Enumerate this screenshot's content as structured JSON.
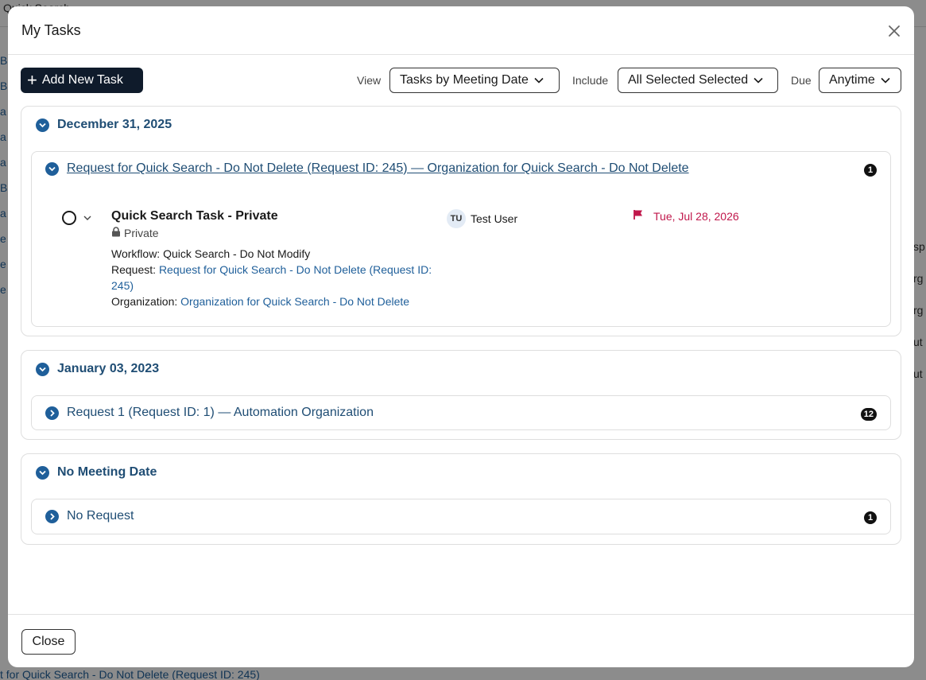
{
  "background": {
    "topbar_text": "Quick Search",
    "left_snippets": [
      "B",
      "B",
      "a",
      "a",
      "a",
      "B",
      "a",
      "e",
      "e",
      "e"
    ],
    "right_snippets": [
      "sp",
      "rg",
      "rg",
      "ut",
      "ut"
    ],
    "bottom_text": "t for Quick Search - Do Not Delete (Request ID: 245)"
  },
  "modal": {
    "title": "My Tasks",
    "close_icon": "close-icon"
  },
  "toolbar": {
    "add_label": "Add New Task",
    "view_label": "View",
    "view_value": "Tasks by Meeting Date",
    "include_label": "Include",
    "include_value": "All Selected Selected",
    "due_label": "Due",
    "due_value": "Anytime"
  },
  "groups": [
    {
      "date": "December 31, 2025",
      "expanded": true,
      "requests": [
        {
          "title": "Request for Quick Search - Do Not Delete (Request ID: 245) — Organization for Quick Search - Do Not Delete",
          "count": "1",
          "expanded": true,
          "task": {
            "title": "Quick Search Task - Private",
            "privacy": "Private",
            "workflow_label": "Workflow:",
            "workflow_value": "Quick Search - Do Not Modify",
            "request_label": "Request:",
            "request_value": "Request for Quick Search - Do Not Delete (Request ID: 245)",
            "org_label": "Organization:",
            "org_value": "Organization for Quick Search - Do Not Delete",
            "assignee_initials": "TU",
            "assignee_name": "Test User",
            "due_date": "Tue, Jul 28, 2026"
          }
        }
      ]
    },
    {
      "date": "January 03, 2023",
      "expanded": true,
      "requests": [
        {
          "title": "Request 1 (Request ID: 1) — Automation Organization",
          "count": "12",
          "expanded": false
        }
      ]
    },
    {
      "date": "No Meeting Date",
      "expanded": true,
      "requests": [
        {
          "title": "No Request",
          "count": "1",
          "expanded": false
        }
      ]
    }
  ],
  "footer": {
    "close_label": "Close"
  },
  "colors": {
    "accent": "#1f5f9a",
    "heading": "#1f4d74",
    "due": "#c0174b",
    "primary_button": "#0f1b2b"
  }
}
